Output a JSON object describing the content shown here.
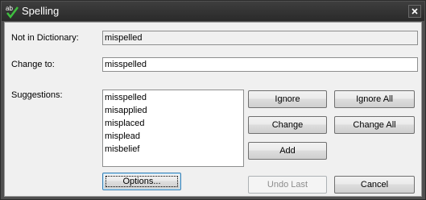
{
  "window": {
    "title": "Spelling"
  },
  "labels": {
    "not_in_dictionary": "Not in Dictionary:",
    "change_to": "Change to:",
    "suggestions": "Suggestions:"
  },
  "fields": {
    "not_in_dictionary_value": "mispelled",
    "change_to_value": "misspelled"
  },
  "suggestions": [
    "misspelled",
    "misapplied",
    "misplaced",
    "misplead",
    "misbelief"
  ],
  "buttons": {
    "ignore": "Ignore",
    "ignore_all": "Ignore All",
    "change": "Change",
    "change_all": "Change All",
    "add": "Add",
    "options": "Options...",
    "undo_last": "Undo Last",
    "cancel": "Cancel"
  },
  "icons": {
    "title": "spellcheck-icon",
    "close": "close-icon"
  },
  "colors": {
    "accent": "#3c7fb1",
    "title_bar": "#2a2a2a",
    "dialog_bg": "#f0f0f0"
  }
}
